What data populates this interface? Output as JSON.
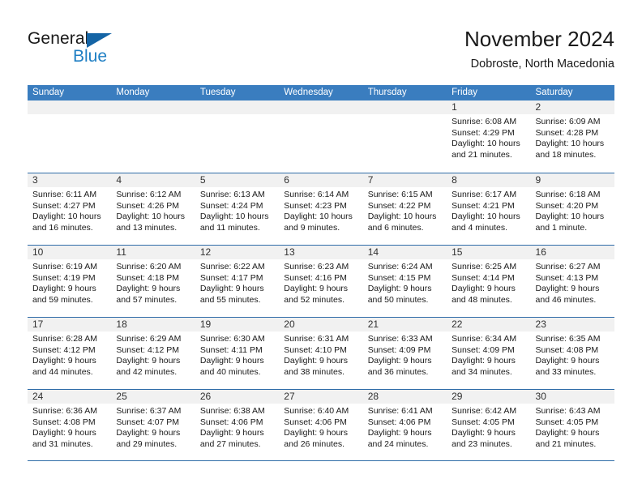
{
  "brand": {
    "name_part1": "General",
    "name_part2": "Blue",
    "triangle_color": "#1464a5",
    "blue_color": "#1f7fc4"
  },
  "header": {
    "title": "November 2024",
    "subtitle": "Dobroste, North Macedonia"
  },
  "theme": {
    "header_band": "#3a7dbf",
    "day_number_band": "#f1f1f1",
    "row_divider": "#2f6ca8",
    "text": "#1a1a1a"
  },
  "weekdays": [
    "Sunday",
    "Monday",
    "Tuesday",
    "Wednesday",
    "Thursday",
    "Friday",
    "Saturday"
  ],
  "labels": {
    "sunrise": "Sunrise:",
    "sunset": "Sunset:",
    "daylight": "Daylight:"
  },
  "weeks": [
    [
      {
        "day": "",
        "empty": true
      },
      {
        "day": "",
        "empty": true
      },
      {
        "day": "",
        "empty": true
      },
      {
        "day": "",
        "empty": true
      },
      {
        "day": "",
        "empty": true
      },
      {
        "day": "1",
        "sunrise": "Sunrise: 6:08 AM",
        "sunset": "Sunset: 4:29 PM",
        "daylight": "Daylight: 10 hours and 21 minutes."
      },
      {
        "day": "2",
        "sunrise": "Sunrise: 6:09 AM",
        "sunset": "Sunset: 4:28 PM",
        "daylight": "Daylight: 10 hours and 18 minutes."
      }
    ],
    [
      {
        "day": "3",
        "sunrise": "Sunrise: 6:11 AM",
        "sunset": "Sunset: 4:27 PM",
        "daylight": "Daylight: 10 hours and 16 minutes."
      },
      {
        "day": "4",
        "sunrise": "Sunrise: 6:12 AM",
        "sunset": "Sunset: 4:26 PM",
        "daylight": "Daylight: 10 hours and 13 minutes."
      },
      {
        "day": "5",
        "sunrise": "Sunrise: 6:13 AM",
        "sunset": "Sunset: 4:24 PM",
        "daylight": "Daylight: 10 hours and 11 minutes."
      },
      {
        "day": "6",
        "sunrise": "Sunrise: 6:14 AM",
        "sunset": "Sunset: 4:23 PM",
        "daylight": "Daylight: 10 hours and 9 minutes."
      },
      {
        "day": "7",
        "sunrise": "Sunrise: 6:15 AM",
        "sunset": "Sunset: 4:22 PM",
        "daylight": "Daylight: 10 hours and 6 minutes."
      },
      {
        "day": "8",
        "sunrise": "Sunrise: 6:17 AM",
        "sunset": "Sunset: 4:21 PM",
        "daylight": "Daylight: 10 hours and 4 minutes."
      },
      {
        "day": "9",
        "sunrise": "Sunrise: 6:18 AM",
        "sunset": "Sunset: 4:20 PM",
        "daylight": "Daylight: 10 hours and 1 minute."
      }
    ],
    [
      {
        "day": "10",
        "sunrise": "Sunrise: 6:19 AM",
        "sunset": "Sunset: 4:19 PM",
        "daylight": "Daylight: 9 hours and 59 minutes."
      },
      {
        "day": "11",
        "sunrise": "Sunrise: 6:20 AM",
        "sunset": "Sunset: 4:18 PM",
        "daylight": "Daylight: 9 hours and 57 minutes."
      },
      {
        "day": "12",
        "sunrise": "Sunrise: 6:22 AM",
        "sunset": "Sunset: 4:17 PM",
        "daylight": "Daylight: 9 hours and 55 minutes."
      },
      {
        "day": "13",
        "sunrise": "Sunrise: 6:23 AM",
        "sunset": "Sunset: 4:16 PM",
        "daylight": "Daylight: 9 hours and 52 minutes."
      },
      {
        "day": "14",
        "sunrise": "Sunrise: 6:24 AM",
        "sunset": "Sunset: 4:15 PM",
        "daylight": "Daylight: 9 hours and 50 minutes."
      },
      {
        "day": "15",
        "sunrise": "Sunrise: 6:25 AM",
        "sunset": "Sunset: 4:14 PM",
        "daylight": "Daylight: 9 hours and 48 minutes."
      },
      {
        "day": "16",
        "sunrise": "Sunrise: 6:27 AM",
        "sunset": "Sunset: 4:13 PM",
        "daylight": "Daylight: 9 hours and 46 minutes."
      }
    ],
    [
      {
        "day": "17",
        "sunrise": "Sunrise: 6:28 AM",
        "sunset": "Sunset: 4:12 PM",
        "daylight": "Daylight: 9 hours and 44 minutes."
      },
      {
        "day": "18",
        "sunrise": "Sunrise: 6:29 AM",
        "sunset": "Sunset: 4:12 PM",
        "daylight": "Daylight: 9 hours and 42 minutes."
      },
      {
        "day": "19",
        "sunrise": "Sunrise: 6:30 AM",
        "sunset": "Sunset: 4:11 PM",
        "daylight": "Daylight: 9 hours and 40 minutes."
      },
      {
        "day": "20",
        "sunrise": "Sunrise: 6:31 AM",
        "sunset": "Sunset: 4:10 PM",
        "daylight": "Daylight: 9 hours and 38 minutes."
      },
      {
        "day": "21",
        "sunrise": "Sunrise: 6:33 AM",
        "sunset": "Sunset: 4:09 PM",
        "daylight": "Daylight: 9 hours and 36 minutes."
      },
      {
        "day": "22",
        "sunrise": "Sunrise: 6:34 AM",
        "sunset": "Sunset: 4:09 PM",
        "daylight": "Daylight: 9 hours and 34 minutes."
      },
      {
        "day": "23",
        "sunrise": "Sunrise: 6:35 AM",
        "sunset": "Sunset: 4:08 PM",
        "daylight": "Daylight: 9 hours and 33 minutes."
      }
    ],
    [
      {
        "day": "24",
        "sunrise": "Sunrise: 6:36 AM",
        "sunset": "Sunset: 4:08 PM",
        "daylight": "Daylight: 9 hours and 31 minutes."
      },
      {
        "day": "25",
        "sunrise": "Sunrise: 6:37 AM",
        "sunset": "Sunset: 4:07 PM",
        "daylight": "Daylight: 9 hours and 29 minutes."
      },
      {
        "day": "26",
        "sunrise": "Sunrise: 6:38 AM",
        "sunset": "Sunset: 4:06 PM",
        "daylight": "Daylight: 9 hours and 27 minutes."
      },
      {
        "day": "27",
        "sunrise": "Sunrise: 6:40 AM",
        "sunset": "Sunset: 4:06 PM",
        "daylight": "Daylight: 9 hours and 26 minutes."
      },
      {
        "day": "28",
        "sunrise": "Sunrise: 6:41 AM",
        "sunset": "Sunset: 4:06 PM",
        "daylight": "Daylight: 9 hours and 24 minutes."
      },
      {
        "day": "29",
        "sunrise": "Sunrise: 6:42 AM",
        "sunset": "Sunset: 4:05 PM",
        "daylight": "Daylight: 9 hours and 23 minutes."
      },
      {
        "day": "30",
        "sunrise": "Sunrise: 6:43 AM",
        "sunset": "Sunset: 4:05 PM",
        "daylight": "Daylight: 9 hours and 21 minutes."
      }
    ]
  ]
}
